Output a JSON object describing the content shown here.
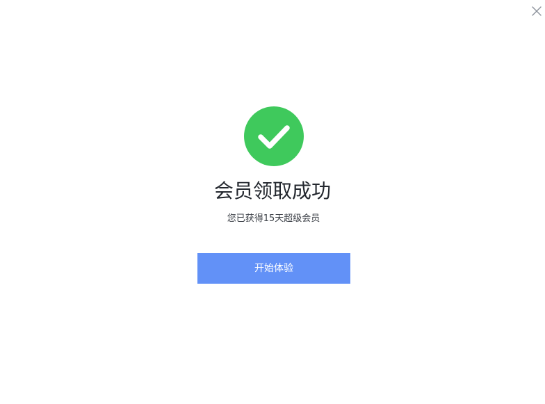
{
  "dialog": {
    "title": "会员领取成功",
    "subtitle": "您已获得15天超级会员",
    "start_button_label": "开始体验"
  },
  "icons": {
    "close": "close-icon",
    "success": "check-circle-icon"
  },
  "colors": {
    "success_green": "#3fc95c",
    "primary_button": "#6291f7",
    "title_text": "#23272e",
    "subtitle_text": "#3d4148",
    "close_icon": "#8a9099"
  }
}
